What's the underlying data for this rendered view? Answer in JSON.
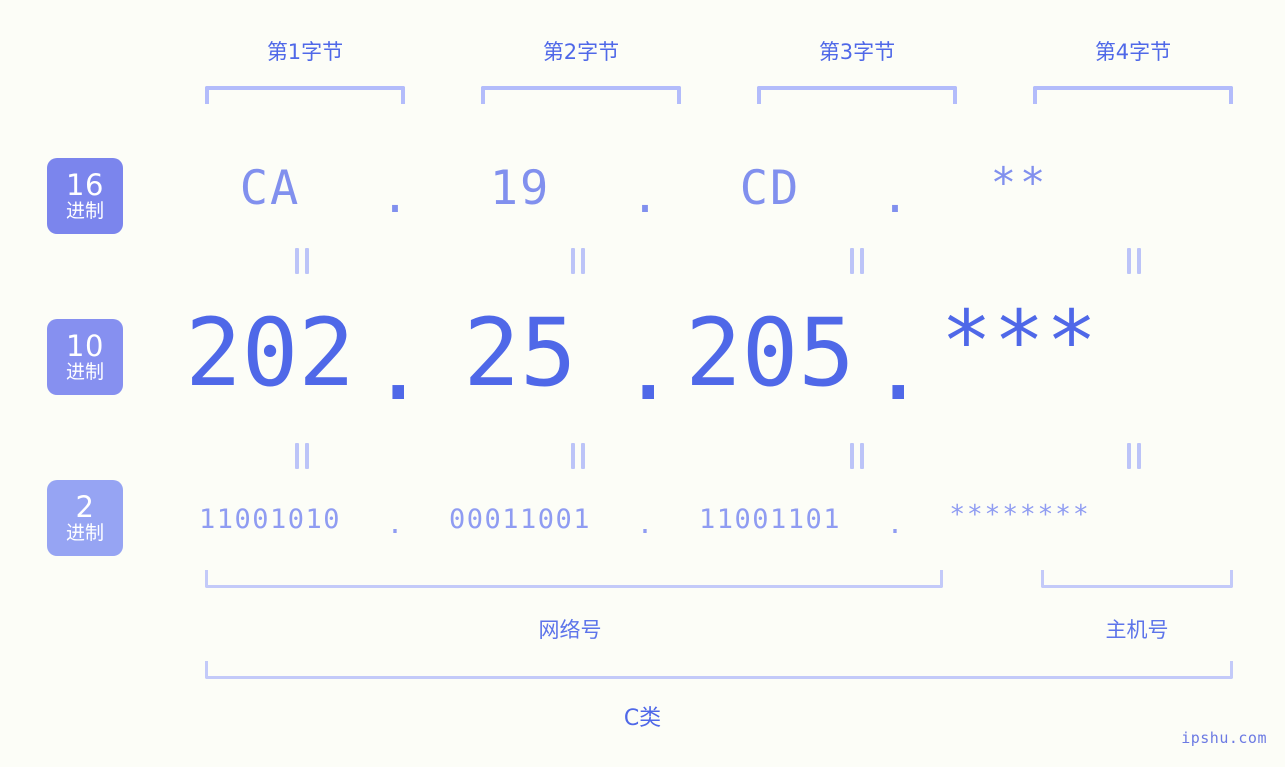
{
  "byte_headers": [
    {
      "label": "第1字节"
    },
    {
      "label": "第2字节"
    },
    {
      "label": "第3字节"
    },
    {
      "label": "第4字节"
    }
  ],
  "bases": [
    {
      "id": "hex",
      "number": "16",
      "unit": "进制"
    },
    {
      "id": "dec",
      "number": "10",
      "unit": "进制"
    },
    {
      "id": "bin",
      "number": "2",
      "unit": "进制"
    }
  ],
  "separator": ".",
  "rows": {
    "hex": {
      "base_number": "16",
      "base_unit": "进制",
      "octets": [
        "CA",
        "19",
        "CD",
        "**"
      ]
    },
    "dec": {
      "base_number": "10",
      "base_unit": "进制",
      "octets": [
        "202",
        "25",
        "205",
        "***"
      ]
    },
    "bin": {
      "base_number": "2",
      "base_unit": "进制",
      "octets": [
        "11001010",
        "00011001",
        "11001101",
        "********"
      ]
    }
  },
  "equality_symbol": "‖",
  "sections": {
    "network": "网络号",
    "host": "主机号"
  },
  "class_label": "C类",
  "watermark": "ipshu.com",
  "colors": {
    "background": "#fcfdf7",
    "hex_text": "#8190ee",
    "dec_text": "#4f68e8",
    "bin_text": "#8f9cf2",
    "bracket": "#b3bcfb",
    "badge_hex": "#7b85ed",
    "badge_dec": "#8690f0",
    "badge_bin": "#96a4f3",
    "label_text": "#4f68e8"
  }
}
